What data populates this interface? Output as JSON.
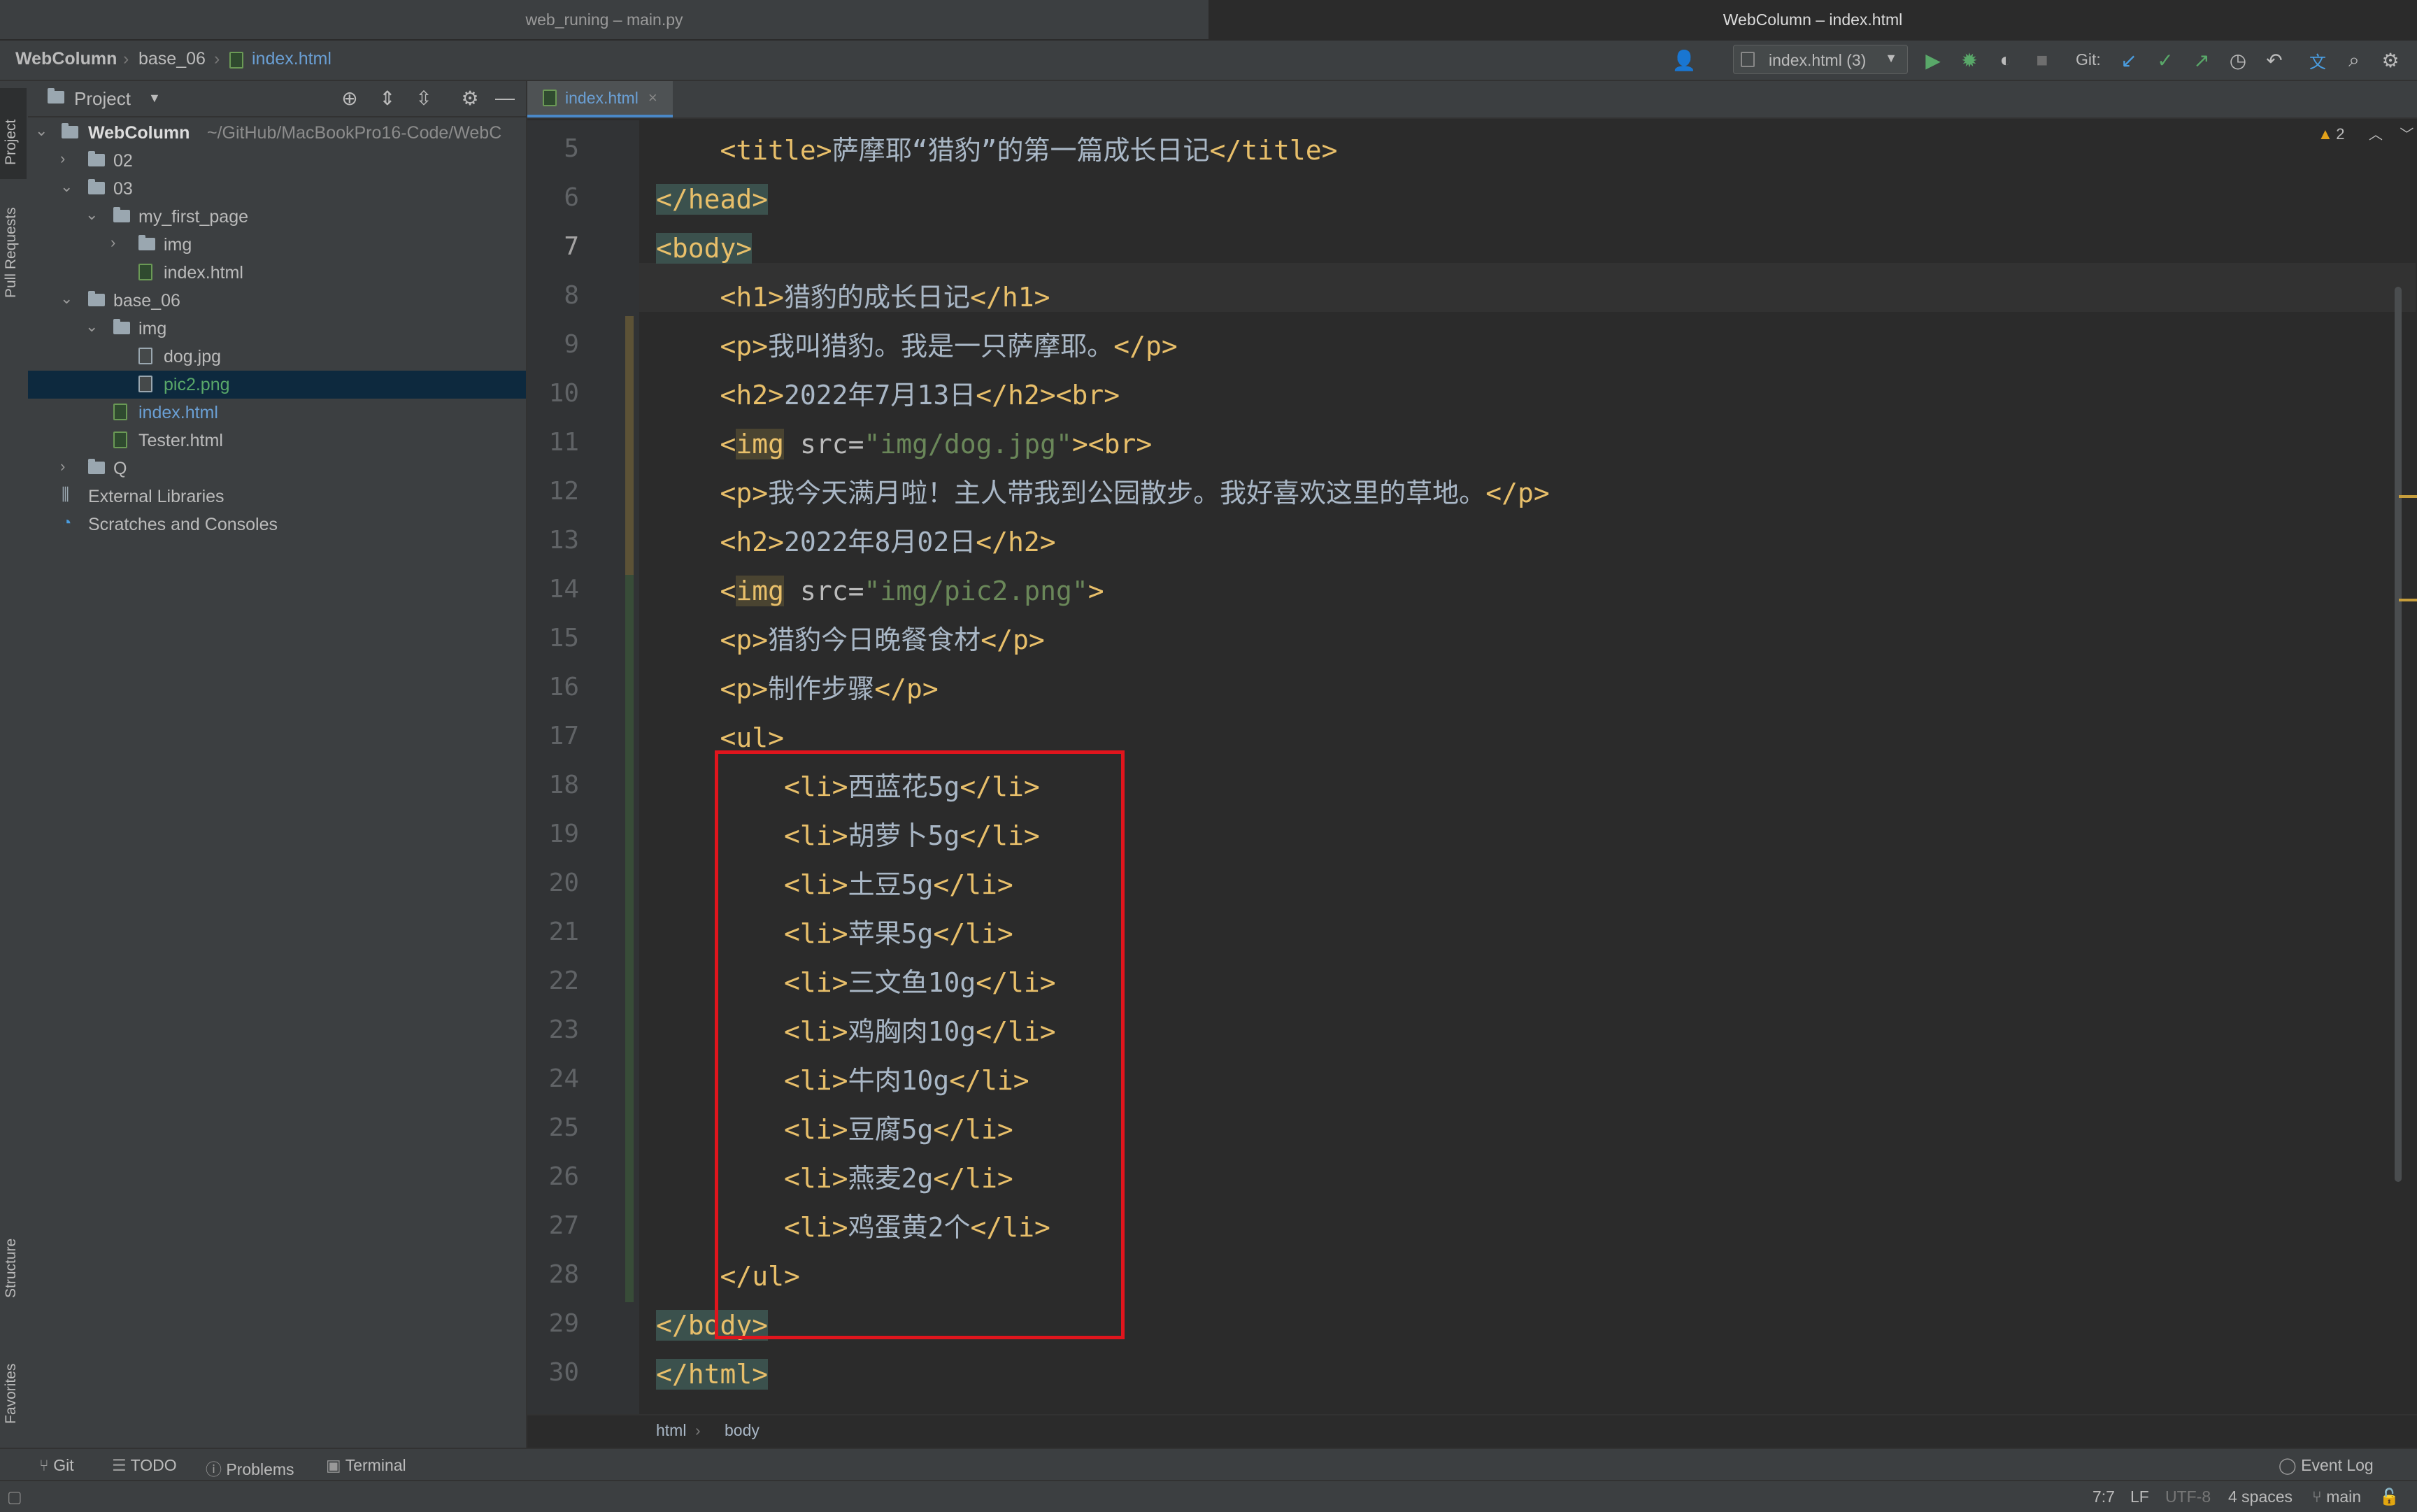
{
  "window_tabs": [
    "web_runing – main.py",
    "WebColumn – index.html"
  ],
  "navbar": {
    "crumbs": [
      "WebColumn",
      "base_06",
      "index.html"
    ],
    "run_config": "index.html (3)",
    "git_label": "Git:"
  },
  "left_stripe": {
    "project": "Project",
    "pull_requests": "Pull Requests",
    "structure": "Structure",
    "favorites": "Favorites"
  },
  "project_panel": {
    "title": "Project",
    "root_name": "WebColumn",
    "root_path": "~/GitHub/MacBookPro16-Code/WebC",
    "tree": [
      {
        "label": "02",
        "kind": "folder"
      },
      {
        "label": "03",
        "kind": "folder"
      },
      {
        "label": "my_first_page",
        "kind": "folder"
      },
      {
        "label": "img",
        "kind": "folder"
      },
      {
        "label": "index.html",
        "kind": "html"
      },
      {
        "label": "base_06",
        "kind": "folder"
      },
      {
        "label": "img",
        "kind": "folder"
      },
      {
        "label": "dog.jpg",
        "kind": "img"
      },
      {
        "label": "pic2.png",
        "kind": "img"
      },
      {
        "label": "index.html",
        "kind": "html"
      },
      {
        "label": "Tester.html",
        "kind": "html"
      },
      {
        "label": "Q",
        "kind": "folder"
      },
      {
        "label": "External Libraries",
        "kind": "lib"
      },
      {
        "label": "Scratches and Consoles",
        "kind": "scratch"
      }
    ]
  },
  "editor": {
    "tab_label": "index.html",
    "warning_count": "2",
    "lines": [
      {
        "n": "5",
        "text": "    <title>萨摩耶“猎豹”的第一篇成长日记</title>"
      },
      {
        "n": "6",
        "text": "</head>"
      },
      {
        "n": "7",
        "text": "<body>"
      },
      {
        "n": "8",
        "text": "    <h1>猎豹的成长日记</h1>"
      },
      {
        "n": "9",
        "text": "    <p>我叫猎豹。我是一只萨摩耶。</p>"
      },
      {
        "n": "10",
        "text": "    <h2>2022年7月13日</h2><br>"
      },
      {
        "n": "11",
        "text": "    <img src=\"img/dog.jpg\"><br>"
      },
      {
        "n": "12",
        "text": "    <p>我今天满月啦！主人带我到公园散步。我好喜欢这里的草地。</p>"
      },
      {
        "n": "13",
        "text": "    <h2>2022年8月02日</h2>"
      },
      {
        "n": "14",
        "text": "    <img src=\"img/pic2.png\">"
      },
      {
        "n": "15",
        "text": "    <p>猎豹今日晚餐食材</p>"
      },
      {
        "n": "16",
        "text": "    <p>制作步骤</p>"
      },
      {
        "n": "17",
        "text": "    <ul>"
      },
      {
        "n": "18",
        "text": "        <li>西蓝花5g</li>"
      },
      {
        "n": "19",
        "text": "        <li>胡萝卜5g</li>"
      },
      {
        "n": "20",
        "text": "        <li>土豆5g</li>"
      },
      {
        "n": "21",
        "text": "        <li>苹果5g</li>"
      },
      {
        "n": "22",
        "text": "        <li>三文鱼10g</li>"
      },
      {
        "n": "23",
        "text": "        <li>鸡胸肉10g</li>"
      },
      {
        "n": "24",
        "text": "        <li>牛肉10g</li>"
      },
      {
        "n": "25",
        "text": "        <li>豆腐5g</li>"
      },
      {
        "n": "26",
        "text": "        <li>燕麦2g</li>"
      },
      {
        "n": "27",
        "text": "        <li>鸡蛋黄2个</li>"
      },
      {
        "n": "28",
        "text": "    </ul>"
      },
      {
        "n": "29",
        "text": "</body>"
      },
      {
        "n": "30",
        "text": "</html>"
      }
    ],
    "breadcrumb": [
      "html",
      "body"
    ]
  },
  "bottom_tools": [
    "Git",
    "TODO",
    "Problems",
    "Terminal",
    "Event Log"
  ],
  "status": {
    "position": "7:7",
    "line_sep": "LF",
    "encoding": "UTF-8",
    "indent": "4 spaces",
    "branch": "main"
  },
  "colors": {
    "tag": "#e8bf6a",
    "attr_value": "#6a8759",
    "text": "#a9b7c6",
    "highlight_box": "#e0151d",
    "selection": "#0d293e"
  }
}
